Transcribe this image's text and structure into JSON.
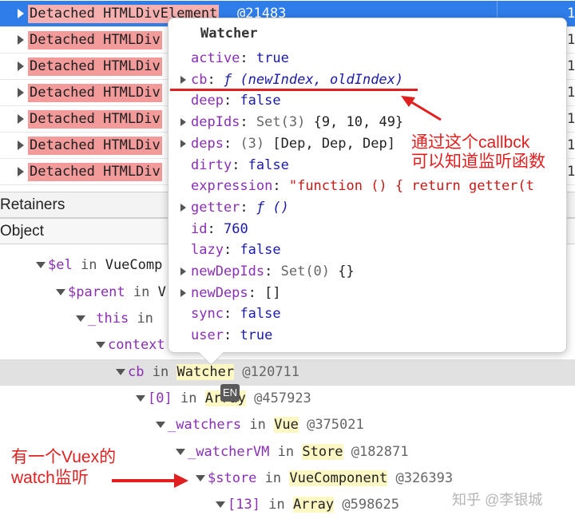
{
  "detached_rows": [
    {
      "label": "Detached HTMLDivElement",
      "id": "@21483",
      "count": "1",
      "selected": true
    },
    {
      "label": "Detached HTMLDiv",
      "id": "",
      "count": "1",
      "selected": false
    },
    {
      "label": "Detached HTMLDiv",
      "id": "",
      "count": "1",
      "selected": false
    },
    {
      "label": "Detached HTMLDiv",
      "id": "",
      "count": "1",
      "selected": false
    },
    {
      "label": "Detached HTMLDiv",
      "id": "",
      "count": "1",
      "selected": false
    },
    {
      "label": "Detached HTMLDiv",
      "id": "",
      "count": "1",
      "selected": false
    },
    {
      "label": "Detached HTMLDiv",
      "id": "",
      "count": "1",
      "selected": false
    }
  ],
  "headers": {
    "retainers": "Retainers",
    "object": "Object"
  },
  "tree": [
    {
      "name": "$el",
      "in": "in",
      "cls": "VueComp",
      "id": ""
    },
    {
      "name": "$parent",
      "in": "in",
      "cls": "V",
      "id": ""
    },
    {
      "name": "_this",
      "in": "in",
      "cls": "",
      "id": ""
    },
    {
      "name": "context",
      "in": "",
      "cls": "",
      "id": ""
    },
    {
      "name": "cb",
      "in": "in",
      "cls": "Watcher",
      "id": "@120711"
    },
    {
      "name": "[0]",
      "in": "in",
      "cls": "Array",
      "id": "@457923"
    },
    {
      "name": "_watchers",
      "in": "in",
      "cls": "Vue",
      "id": "@375021"
    },
    {
      "name": "_watcherVM",
      "in": "in",
      "cls": "Store",
      "id": "@182871"
    },
    {
      "name": "$store",
      "in": "in",
      "cls": "VueComponent",
      "id": "@326393"
    },
    {
      "name": "[13]",
      "in": "in",
      "cls": "Array",
      "id": "@598625"
    }
  ],
  "popover": {
    "title": "Watcher",
    "props": [
      {
        "key": "active",
        "value": "true",
        "type": "bool",
        "expandable": false
      },
      {
        "key": "cb",
        "value": "ƒ (newIndex, oldIndex)",
        "type": "fn",
        "expandable": true
      },
      {
        "key": "deep",
        "value": "false",
        "type": "bool",
        "expandable": false
      },
      {
        "key": "depIds",
        "value": "Set(3)",
        "extra": "{9, 10, 49}",
        "type": "set",
        "expandable": true
      },
      {
        "key": "deps",
        "value": "(3)",
        "extra": "[Dep, Dep, Dep]",
        "type": "set",
        "expandable": true
      },
      {
        "key": "dirty",
        "value": "false",
        "type": "bool",
        "expandable": false
      },
      {
        "key": "expression",
        "value": "\"function () { return getter(t",
        "type": "str",
        "expandable": false
      },
      {
        "key": "getter",
        "value": "ƒ ()",
        "type": "fn",
        "expandable": true
      },
      {
        "key": "id",
        "value": "760",
        "type": "num",
        "expandable": false
      },
      {
        "key": "lazy",
        "value": "false",
        "type": "bool",
        "expandable": false
      },
      {
        "key": "newDepIds",
        "value": "Set(0)",
        "extra": "{}",
        "type": "set",
        "expandable": true
      },
      {
        "key": "newDeps",
        "value": "[]",
        "type": "obj",
        "expandable": true
      },
      {
        "key": "sync",
        "value": "false",
        "type": "bool",
        "expandable": false
      },
      {
        "key": "user",
        "value": "true",
        "type": "bool",
        "expandable": false
      }
    ]
  },
  "annotations": {
    "callback_note_line1": "通过这个callbck",
    "callback_note_line2": "可以知道监听函数",
    "vuex_note_line1": "有一个Vuex的",
    "vuex_note_line2": "watch监听"
  },
  "ime_badge": "EN",
  "watermark": "知乎 @李银城",
  "colors": {
    "selection": "#2f7de8",
    "detached_bg": "#f39b9b",
    "annotation": "#e02020",
    "highlight_class": "#fdf7c4"
  }
}
